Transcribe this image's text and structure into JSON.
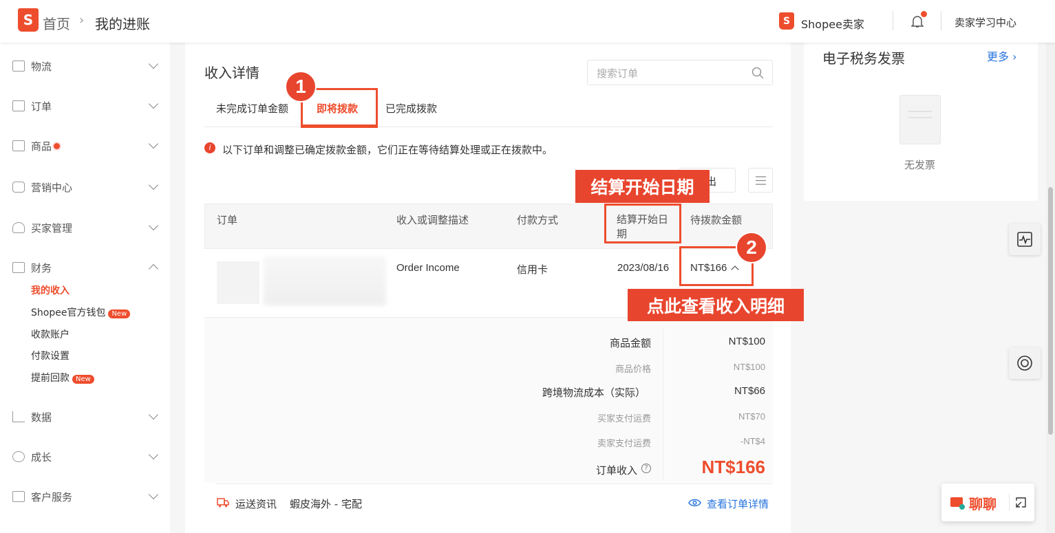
{
  "header": {
    "home": "首页",
    "current": "我的进账",
    "brand": "Shopee卖家",
    "learning": "卖家学习中心"
  },
  "sidebar": {
    "items": [
      {
        "label": "物流"
      },
      {
        "label": "订单"
      },
      {
        "label": "商品"
      },
      {
        "label": "营销中心"
      },
      {
        "label": "买家管理"
      },
      {
        "label": "财务"
      },
      {
        "label": "数据"
      },
      {
        "label": "成长"
      },
      {
        "label": "客户服务"
      }
    ],
    "finance_sub": [
      {
        "label": "我的收入"
      },
      {
        "label": "Shopee官方钱包",
        "badge": "New"
      },
      {
        "label": "收款账户"
      },
      {
        "label": "付款设置"
      },
      {
        "label": "提前回款",
        "badge": "New"
      }
    ]
  },
  "main": {
    "title": "收入详情",
    "search_placeholder": "搜索订单",
    "tabs": [
      "未完成订单金额",
      "即将拨款",
      "已完成拨款"
    ],
    "notice": "以下订单和调整已确定拨款金额，它们正在等待结算处理或正在拨款中。",
    "export_label": "出",
    "columns": [
      "订单",
      "收入或调整描述",
      "付款方式",
      "结算开始日期",
      "待拨款金额"
    ],
    "row": {
      "desc": "Order Income",
      "payment": "信用卡",
      "date": "2023/08/16",
      "amount": "NT$166"
    },
    "breakdown": [
      {
        "label": "商品金额",
        "value": "NT$100"
      },
      {
        "label": "商品价格",
        "value": "NT$100"
      },
      {
        "label": "跨境物流成本（实际）",
        "value": "NT$66"
      },
      {
        "label": "买家支付运费",
        "value": "NT$70"
      },
      {
        "label": "卖家支付运费",
        "value": "-NT$4"
      }
    ],
    "order_income_label": "订单收入",
    "order_income_value": "NT$166",
    "shipping_label": "运送资讯",
    "shipping_value": "蝦皮海外 - 宅配",
    "view_order": "查看订单详情"
  },
  "right": {
    "title": "电子税务发票",
    "more": "更多",
    "empty": "无发票"
  },
  "annotations": {
    "step1": "1",
    "step2": "2",
    "date_callout": "结算开始日期",
    "detail_callout": "点此查看收入明细"
  },
  "chat": {
    "label": "聊聊"
  },
  "colors": {
    "brand": "#ee4d2d",
    "callout": "#e8452e",
    "link": "#2673dd"
  }
}
